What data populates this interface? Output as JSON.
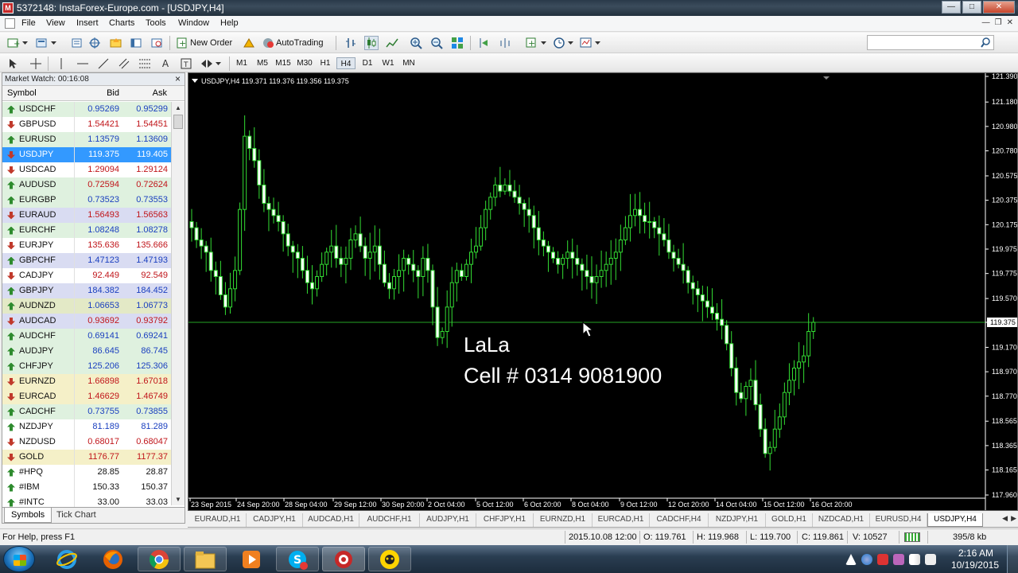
{
  "window": {
    "title": "5372148: InstaForex-Europe.com - [USDJPY,H4]",
    "app_icon": "metatrader-icon"
  },
  "menu": {
    "items": [
      "File",
      "View",
      "Insert",
      "Charts",
      "Tools",
      "Window",
      "Help"
    ]
  },
  "toolbar": {
    "new_order_label": "New Order",
    "autotrading_label": "AutoTrading",
    "timeframes": [
      "M1",
      "M5",
      "M15",
      "M30",
      "H1",
      "H4",
      "D1",
      "W1",
      "MN"
    ],
    "active_timeframe": "H4"
  },
  "market_watch": {
    "header": "Market Watch: 00:16:08",
    "columns": {
      "symbol": "Symbol",
      "bid": "Bid",
      "ask": "Ask"
    },
    "rows": [
      {
        "symbol": "USDCHF",
        "bid": "0.95269",
        "ask": "0.95299",
        "dir": "up",
        "color": "blue",
        "bg": "#dff1df"
      },
      {
        "symbol": "GBPUSD",
        "bid": "1.54421",
        "ask": "1.54451",
        "dir": "down",
        "color": "red",
        "bg": "#ffffff"
      },
      {
        "symbol": "EURUSD",
        "bid": "1.13579",
        "ask": "1.13609",
        "dir": "up",
        "color": "blue",
        "bg": "#dff1df"
      },
      {
        "symbol": "USDJPY",
        "bid": "119.375",
        "ask": "119.405",
        "dir": "down",
        "color": "blue",
        "bg": "#3399ff",
        "selected": true
      },
      {
        "symbol": "USDCAD",
        "bid": "1.29094",
        "ask": "1.29124",
        "dir": "down",
        "color": "red",
        "bg": "#ffffff"
      },
      {
        "symbol": "AUDUSD",
        "bid": "0.72594",
        "ask": "0.72624",
        "dir": "up",
        "color": "red",
        "bg": "#dff1df"
      },
      {
        "symbol": "EURGBP",
        "bid": "0.73523",
        "ask": "0.73553",
        "dir": "up",
        "color": "blue",
        "bg": "#dff1df"
      },
      {
        "symbol": "EURAUD",
        "bid": "1.56493",
        "ask": "1.56563",
        "dir": "down",
        "color": "red",
        "bg": "#d9dcf2"
      },
      {
        "symbol": "EURCHF",
        "bid": "1.08248",
        "ask": "1.08278",
        "dir": "up",
        "color": "blue",
        "bg": "#dff1df"
      },
      {
        "symbol": "EURJPY",
        "bid": "135.636",
        "ask": "135.666",
        "dir": "down",
        "color": "red",
        "bg": "#ffffff"
      },
      {
        "symbol": "GBPCHF",
        "bid": "1.47123",
        "ask": "1.47193",
        "dir": "up",
        "color": "blue",
        "bg": "#d9dcf2"
      },
      {
        "symbol": "CADJPY",
        "bid": "92.449",
        "ask": "92.549",
        "dir": "down",
        "color": "red",
        "bg": "#ffffff"
      },
      {
        "symbol": "GBPJPY",
        "bid": "184.382",
        "ask": "184.452",
        "dir": "up",
        "color": "blue",
        "bg": "#d9dcf2"
      },
      {
        "symbol": "AUDNZD",
        "bid": "1.06653",
        "ask": "1.06773",
        "dir": "up",
        "color": "blue",
        "bg": "#e3e9c6"
      },
      {
        "symbol": "AUDCAD",
        "bid": "0.93692",
        "ask": "0.93792",
        "dir": "down",
        "color": "red",
        "bg": "#d9dcf2"
      },
      {
        "symbol": "AUDCHF",
        "bid": "0.69141",
        "ask": "0.69241",
        "dir": "up",
        "color": "blue",
        "bg": "#dff1df"
      },
      {
        "symbol": "AUDJPY",
        "bid": "86.645",
        "ask": "86.745",
        "dir": "up",
        "color": "blue",
        "bg": "#dff1df"
      },
      {
        "symbol": "CHFJPY",
        "bid": "125.206",
        "ask": "125.306",
        "dir": "up",
        "color": "blue",
        "bg": "#dff1df"
      },
      {
        "symbol": "EURNZD",
        "bid": "1.66898",
        "ask": "1.67018",
        "dir": "down",
        "color": "red",
        "bg": "#f5f0c8"
      },
      {
        "symbol": "EURCAD",
        "bid": "1.46629",
        "ask": "1.46749",
        "dir": "down",
        "color": "red",
        "bg": "#f5f0c8"
      },
      {
        "symbol": "CADCHF",
        "bid": "0.73755",
        "ask": "0.73855",
        "dir": "up",
        "color": "blue",
        "bg": "#dff1df"
      },
      {
        "symbol": "NZDJPY",
        "bid": "81.189",
        "ask": "81.289",
        "dir": "up",
        "color": "blue",
        "bg": "#ffffff"
      },
      {
        "symbol": "NZDUSD",
        "bid": "0.68017",
        "ask": "0.68047",
        "dir": "down",
        "color": "red",
        "bg": "#ffffff"
      },
      {
        "symbol": "GOLD",
        "bid": "1176.77",
        "ask": "1177.37",
        "dir": "down",
        "color": "red",
        "bg": "#f5f0c8"
      },
      {
        "symbol": "#HPQ",
        "bid": "28.85",
        "ask": "28.87",
        "dir": "up",
        "color": "black",
        "bg": "#ffffff"
      },
      {
        "symbol": "#IBM",
        "bid": "150.33",
        "ask": "150.37",
        "dir": "up",
        "color": "black",
        "bg": "#ffffff"
      },
      {
        "symbol": "#INTC",
        "bid": "33.00",
        "ask": "33.03",
        "dir": "up",
        "color": "black",
        "bg": "#ffffff"
      }
    ],
    "tabs": [
      "Symbols",
      "Tick Chart"
    ],
    "active_tab": "Symbols"
  },
  "chart": {
    "label": "USDJPY,H4  119.371 119.376 119.356 119.375",
    "overlay_name": "LaLa",
    "overlay_phone": "Cell # 0314 9081900",
    "price_labels": [
      "121.390",
      "121.180",
      "120.980",
      "120.780",
      "120.575",
      "120.375",
      "120.175",
      "119.975",
      "119.775",
      "119.570",
      "119.375",
      "119.170",
      "118.970",
      "118.770",
      "118.565",
      "118.365",
      "118.165",
      "117.960"
    ],
    "current_price": "119.375",
    "time_labels": [
      "23 Sep 2015",
      "24 Sep 20:00",
      "28 Sep 04:00",
      "29 Sep 12:00",
      "30 Sep 20:00",
      "2 Oct 04:00",
      "5 Oct 12:00",
      "6 Oct 20:00",
      "8 Oct 04:00",
      "9 Oct 12:00",
      "12 Oct 20:00",
      "14 Oct 04:00",
      "15 Oct 12:00",
      "16 Oct 20:00"
    ],
    "colors": {
      "background": "#000000",
      "candle": "#33dd33",
      "bull_fill": "#000000",
      "bear_fill": "#ffffff",
      "grid": "#33dd33"
    }
  },
  "chart_data": {
    "type": "candlestick",
    "series_name": "USDJPY,H4",
    "ylim": [
      117.96,
      121.39
    ],
    "close_path": [
      120.15,
      120.05,
      120.0,
      119.95,
      119.8,
      119.75,
      119.6,
      119.5,
      119.65,
      119.8,
      120.3,
      120.9,
      120.8,
      120.7,
      120.5,
      120.35,
      120.3,
      120.25,
      120.2,
      120.1,
      120.0,
      119.95,
      119.9,
      119.8,
      119.7,
      119.65,
      119.75,
      119.85,
      119.95,
      120.0,
      119.9,
      119.85,
      119.9,
      120.05,
      120.1,
      120.0,
      119.9,
      119.95,
      120.0,
      119.85,
      119.7,
      119.65,
      119.75,
      119.8,
      119.9,
      119.85,
      119.8,
      119.75,
      119.9,
      119.8,
      119.5,
      119.25,
      119.3,
      119.5,
      119.7,
      119.8,
      119.75,
      119.85,
      119.95,
      120.0,
      120.15,
      120.3,
      120.4,
      120.5,
      120.45,
      120.5,
      120.45,
      120.4,
      120.35,
      120.3,
      120.25,
      120.15,
      120.05,
      120.0,
      119.95,
      119.9,
      119.85,
      119.9,
      119.95,
      119.9,
      119.85,
      119.8,
      119.75,
      119.7,
      119.75,
      119.8,
      119.85,
      119.9,
      119.95,
      120.05,
      120.15,
      120.25,
      120.3,
      120.25,
      120.2,
      120.2,
      120.15,
      120.1,
      120.05,
      119.95,
      119.9,
      119.85,
      119.8,
      119.7,
      119.65,
      119.6,
      119.55,
      119.5,
      119.45,
      119.4,
      119.35,
      119.2,
      119.0,
      118.8,
      118.75,
      118.85,
      118.9,
      118.7,
      118.5,
      118.3,
      118.35,
      118.5,
      118.6,
      118.8,
      118.9,
      119.0,
      119.05,
      119.1,
      119.3,
      119.375
    ]
  },
  "chart_tabs": {
    "items": [
      "EURAUD,H1",
      "CADJPY,H1",
      "AUDCAD,H1",
      "AUDCHF,H1",
      "AUDJPY,H1",
      "CHFJPY,H1",
      "EURNZD,H1",
      "EURCAD,H1",
      "CADCHF,H4",
      "NZDJPY,H1",
      "GOLD,H1",
      "NZDCAD,H1",
      "EURUSD,H4",
      "USDJPY,H4"
    ],
    "active": "USDJPY,H4"
  },
  "status": {
    "help": "For Help, press F1",
    "datetime": "2015.10.08 12:00",
    "open": "O: 119.761",
    "high": "H: 119.968",
    "low": "L: 119.700",
    "close": "C: 119.861",
    "volume": "V: 10527",
    "traffic": "395/8 kb"
  },
  "taskbar": {
    "time": "2:16 AM",
    "date": "10/19/2015"
  }
}
